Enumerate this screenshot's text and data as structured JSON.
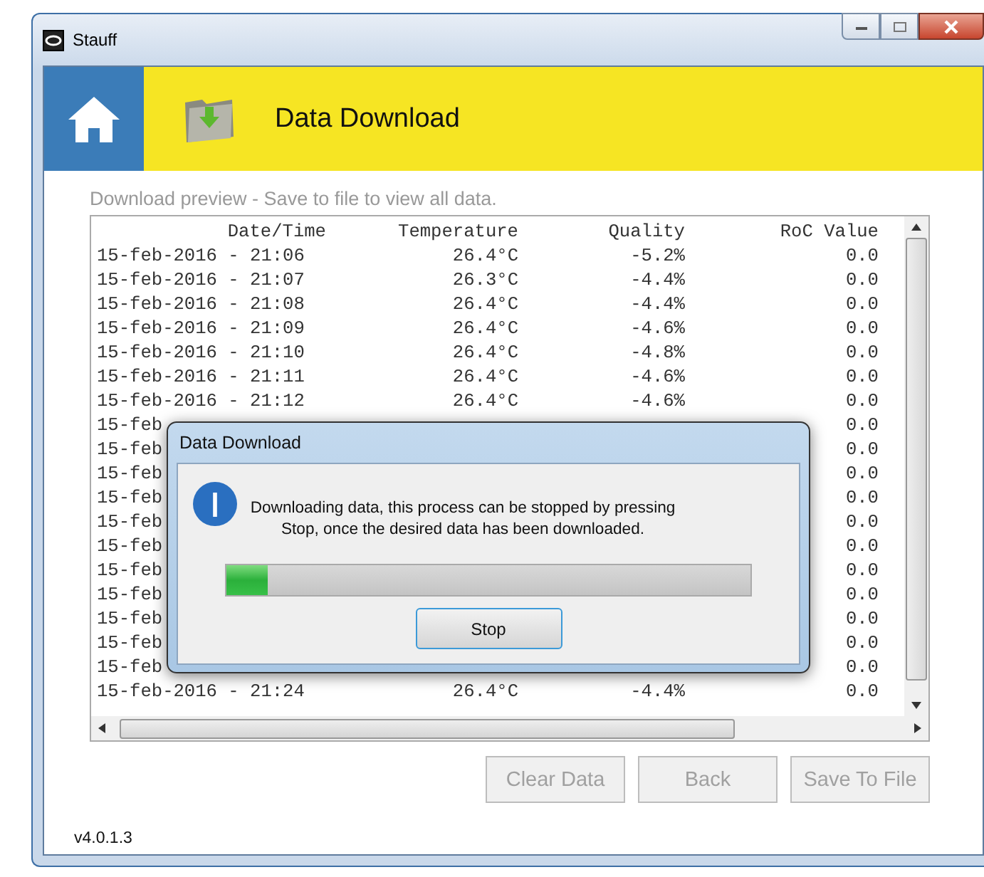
{
  "window": {
    "title": "Stauff"
  },
  "header": {
    "title": "Data Download"
  },
  "preview_label": "Download preview - Save to file to view all data.",
  "table": {
    "columns": [
      "Date/Time",
      "Temperature",
      "Quality",
      "RoC Value"
    ],
    "rows": [
      {
        "date_time": "15-feb-2016 - 21:06",
        "temperature": "26.4°C",
        "quality": "-5.2%",
        "roc_value": "0.0"
      },
      {
        "date_time": "15-feb-2016 - 21:07",
        "temperature": "26.3°C",
        "quality": "-4.4%",
        "roc_value": "0.0"
      },
      {
        "date_time": "15-feb-2016 - 21:08",
        "temperature": "26.4°C",
        "quality": "-4.4%",
        "roc_value": "0.0"
      },
      {
        "date_time": "15-feb-2016 - 21:09",
        "temperature": "26.4°C",
        "quality": "-4.6%",
        "roc_value": "0.0"
      },
      {
        "date_time": "15-feb-2016 - 21:10",
        "temperature": "26.4°C",
        "quality": "-4.8%",
        "roc_value": "0.0"
      },
      {
        "date_time": "15-feb-2016 - 21:11",
        "temperature": "26.4°C",
        "quality": "-4.6%",
        "roc_value": "0.0"
      },
      {
        "date_time": "15-feb-2016 - 21:12",
        "temperature": "26.4°C",
        "quality": "-4.6%",
        "roc_value": "0.0"
      },
      {
        "date_time": "15-feb",
        "roc_value": "0.0"
      },
      {
        "date_time": "15-feb",
        "roc_value": "0.0"
      },
      {
        "date_time": "15-feb",
        "roc_value": "0.0"
      },
      {
        "date_time": "15-feb",
        "roc_value": "0.0"
      },
      {
        "date_time": "15-feb",
        "roc_value": "0.0"
      },
      {
        "date_time": "15-feb",
        "roc_value": "0.0"
      },
      {
        "date_time": "15-feb",
        "roc_value": "0.0"
      },
      {
        "date_time": "15-feb",
        "roc_value": "0.0"
      },
      {
        "date_time": "15-feb",
        "roc_value": "0.0"
      },
      {
        "date_time": "15-feb",
        "roc_value": "0.0"
      },
      {
        "date_time": "15-feb",
        "roc_value": "0.0"
      },
      {
        "date_time": "15-feb-2016 - 21:24",
        "temperature": "26.4°C",
        "quality": "-4.4%",
        "roc_value": "0.0"
      }
    ]
  },
  "buttons": [
    {
      "label": "Clear Data",
      "disabled": true
    },
    {
      "label": "Back",
      "disabled": true
    },
    {
      "label": "Save To File",
      "disabled": true
    }
  ],
  "version": "v4.0.1.3",
  "dialog": {
    "title": "Data Download",
    "message": "Downloading data, this process can be stopped by pressing Stop, once the desired data has been downloaded.",
    "progress": {
      "level": 0.08
    },
    "button": "Stop"
  }
}
